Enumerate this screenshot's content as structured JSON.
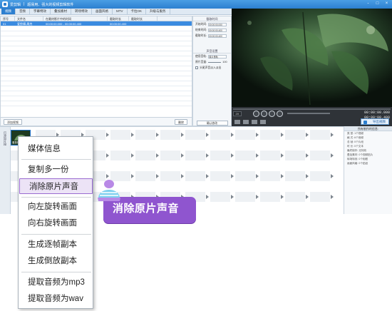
{
  "window": {
    "title": "爱剪辑",
    "subtitle": "超易用、强大的视频剪辑软件",
    "controls": [
      "-",
      "□",
      "×"
    ]
  },
  "menu": {
    "tabs": [
      "视频",
      "音频",
      "字幕特效",
      "叠加素材",
      "转场特效",
      "画面风格",
      "MTV",
      "卡拉OK",
      "升级与服务"
    ],
    "active_index": 0
  },
  "file_list": {
    "columns": [
      "序号",
      "文件名",
      "在最终影片中的时间",
      "截取时长",
      "截取时长"
    ],
    "rows": [
      {
        "index": "01",
        "name": "爱剪辑-周杰",
        "time": "00:00:00.000 - 00:00:00.400",
        "dur": "00:00:00.400"
      }
    ],
    "add_button": "添加视频",
    "delete_button": "删除"
  },
  "settings": {
    "section1": "截取时间",
    "start_label": "开始时间:",
    "end_label": "结束时间:",
    "duration_label": "截取时长:",
    "start_val": "00:00:00.000",
    "end_val": "00:00:00.400",
    "dur_val": "00:00:00.400",
    "section2": "声音设置",
    "track_label": "使用音轨:",
    "track_val": "原片音轨",
    "volume_label": "原片音量:",
    "volume_val": "100",
    "fade_label": "头尾声音淡入淡出",
    "button_label": "确认修改"
  },
  "player": {
    "time_current": "00:00:00.000",
    "time_total": "00:00:00.400",
    "zoom_label": "2X",
    "export_button": "导出视频"
  },
  "timeline": {
    "side_label": "已添加片段",
    "clip_checks": "爱剪辑",
    "info_title": "所有制作的信息:",
    "info_rows": [
      "类  型:  1个视频",
      "格  式:  6个音频",
      "总  帧:  0个片段",
      "时  长:  0个文本",
      "最终制作:  无特效",
      "叠加素材:  0个视频贴片",
      "转场特效:  0个相框",
      "画面风格:  0个贴纸"
    ]
  },
  "context_menu": {
    "items": [
      {
        "label": "媒体信息"
      },
      {
        "label": "复制多一份"
      },
      {
        "label": "消除原片声音",
        "highlighted": true
      },
      {
        "label": "向左旋转画面"
      },
      {
        "label": "向右旋转画面"
      },
      {
        "label": "生成逐帧副本"
      },
      {
        "label": "生成倒放副本"
      },
      {
        "label": "提取音频为mp3"
      },
      {
        "label": "提取音频为wav"
      }
    ]
  },
  "callout": {
    "text": "消除原片声音"
  },
  "colors": {
    "accent": "#2c7fd0",
    "callout": "#8f55cf",
    "highlight_border": "#9a6bd1",
    "highlight_bg": "#ece3f6"
  }
}
